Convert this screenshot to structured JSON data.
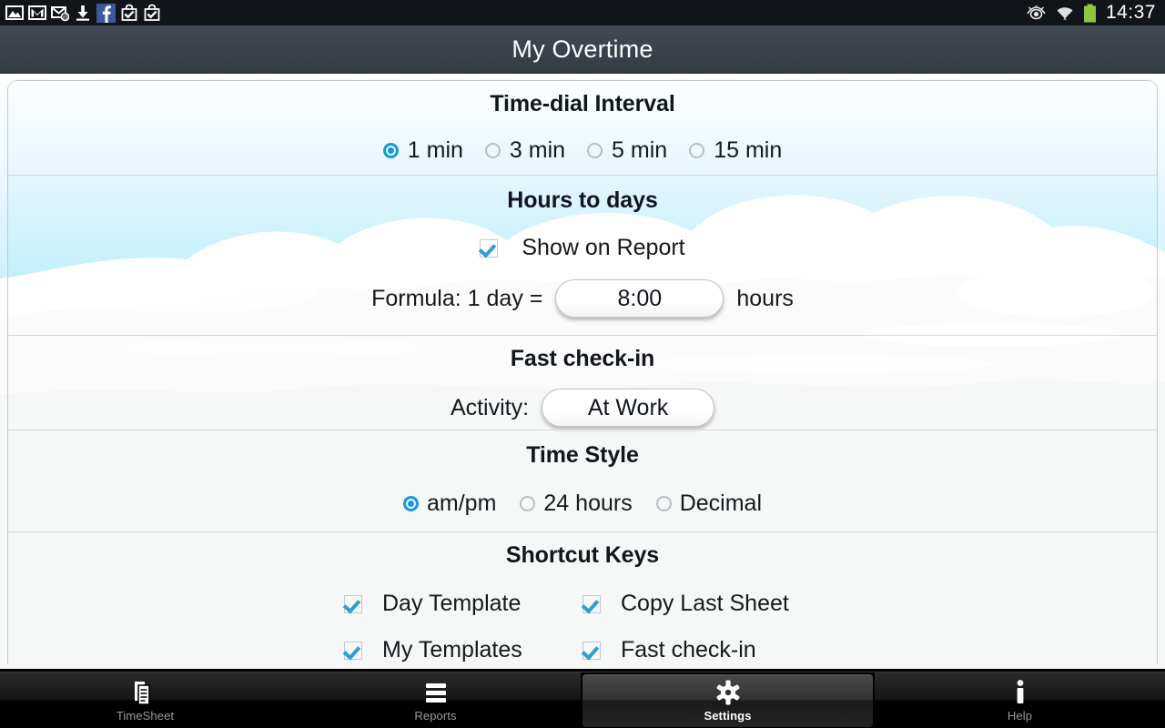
{
  "status_bar": {
    "left_icons": [
      "gallery-icon",
      "gmail-icon",
      "email-at-icon",
      "download-icon",
      "facebook-icon",
      "checkmark-bag-icon",
      "checkmark-bag-icon-2"
    ],
    "right_icons": [
      "smart-stay-eye-icon",
      "wifi-icon",
      "battery-icon"
    ],
    "clock": "14:37",
    "battery_color": "#8ec640",
    "background": "#11151a"
  },
  "title_bar": {
    "title": "My Overtime",
    "background": "#3b424b"
  },
  "theme": {
    "accent_blue": "#1b9ad8",
    "check_blue": "#2f9dd4",
    "sky_blue": "#8fe2fa",
    "text": "#10161c"
  },
  "sections": {
    "time_dial": {
      "title": "Time-dial Interval",
      "options": [
        {
          "label": "1 min",
          "selected": true
        },
        {
          "label": "3 min",
          "selected": false
        },
        {
          "label": "5 min",
          "selected": false
        },
        {
          "label": "15 min",
          "selected": false
        }
      ]
    },
    "hours_to_days": {
      "title": "Hours to days",
      "show_on_report": {
        "label": "Show on Report",
        "checked": true
      },
      "formula_prefix": "Formula: 1 day =",
      "formula_value": "8:00",
      "formula_suffix": "hours"
    },
    "fast_checkin": {
      "title": "Fast check-in",
      "activity_label": "Activity:",
      "activity_value": "At Work"
    },
    "time_style": {
      "title": "Time Style",
      "options": [
        {
          "label": "am/pm",
          "selected": true
        },
        {
          "label": "24 hours",
          "selected": false
        },
        {
          "label": "Decimal",
          "selected": false
        }
      ]
    },
    "shortcut_keys": {
      "title": "Shortcut Keys",
      "items": [
        {
          "label": "Day Template",
          "checked": true
        },
        {
          "label": "Copy Last Sheet",
          "checked": true
        },
        {
          "label": "My Templates",
          "checked": true
        },
        {
          "label": "Fast check-in",
          "checked": true
        }
      ]
    }
  },
  "bottom_nav": {
    "tabs": [
      {
        "label": "TimeSheet",
        "icon": "documents-icon",
        "active": false
      },
      {
        "label": "Reports",
        "icon": "list-icon",
        "active": false
      },
      {
        "label": "Settings",
        "icon": "gear-icon",
        "active": true
      },
      {
        "label": "Help",
        "icon": "info-icon",
        "active": false
      }
    ]
  }
}
